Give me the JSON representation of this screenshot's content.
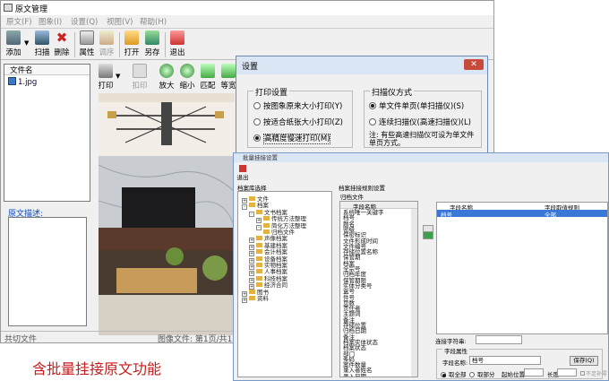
{
  "main_window": {
    "title": "原文管理",
    "menu": [
      "原文(F)",
      "图象(I)",
      "设置(Q)",
      "视图(V)",
      "帮助(H)"
    ],
    "toolbar": [
      {
        "label": "添加",
        "icon": "add-icon"
      },
      {
        "label": "扫描",
        "icon": "scan-icon"
      },
      {
        "label": "删除",
        "icon": "delete-icon"
      },
      {
        "label": "属性",
        "icon": "properties-icon"
      },
      {
        "label": "调序",
        "icon": "reorder-icon",
        "disabled": true
      },
      {
        "label": "打开",
        "icon": "open-icon"
      },
      {
        "label": "另存",
        "icon": "save-as-icon"
      },
      {
        "label": "退出",
        "icon": "exit-icon"
      }
    ],
    "file_panel": {
      "header": "文件名",
      "files": [
        "1.jpg"
      ]
    },
    "description_label": "原文描述:",
    "image_toolbar": [
      {
        "label": "打印",
        "icon": "print-icon"
      },
      {
        "label": "扣印",
        "icon": "stamp-icon",
        "disabled": true
      },
      {
        "label": "放大",
        "icon": "zoom-in-icon"
      },
      {
        "label": "缩小",
        "icon": "zoom-out-icon"
      },
      {
        "label": "匹配",
        "icon": "fit-icon"
      },
      {
        "label": "等宽",
        "icon": "fit-width-icon"
      }
    ],
    "status": {
      "left": "共切文件",
      "right": "图像文件: 第1页/共1页"
    }
  },
  "settings_dialog": {
    "title": "设置",
    "print_group": {
      "title": "打印设置",
      "options": [
        "按图象原来大小打印(Y)",
        "按适合纸张大小打印(Z)",
        "高精度慢速打印(M)"
      ],
      "selected": 2
    },
    "scan_group": {
      "title": "扫描仪方式",
      "options": [
        "单文件单页(单扫描仪)(S)",
        "连续扫描仪(高速扫描仪)(L)"
      ],
      "selected": 0,
      "note": "注: 有些高速扫描仪可设为单文件单页方式。"
    },
    "close_icon": "close-icon"
  },
  "batch_dialog": {
    "title": "批量挂接设置",
    "exit_label": "退出",
    "left_title": "档案库选择",
    "tree": [
      {
        "label": "文件",
        "indent": 0,
        "box": "+"
      },
      {
        "label": "档案",
        "indent": 0,
        "box": "-"
      },
      {
        "label": "文书档案",
        "indent": 1,
        "box": "-"
      },
      {
        "label": "传统方法整理",
        "indent": 2,
        "box": "+"
      },
      {
        "label": "简化方法整理",
        "indent": 2,
        "box": "-"
      },
      {
        "label": "归档文件",
        "indent": 3,
        "box": ""
      },
      {
        "label": "声像档案",
        "indent": 1,
        "box": "+"
      },
      {
        "label": "基建档案",
        "indent": 1,
        "box": "+"
      },
      {
        "label": "会计档案",
        "indent": 1,
        "box": "+"
      },
      {
        "label": "设备档案",
        "indent": 1,
        "box": "+"
      },
      {
        "label": "实物档案",
        "indent": 1,
        "box": "+"
      },
      {
        "label": "人事档案",
        "indent": 1,
        "box": "+"
      },
      {
        "label": "科技档案",
        "indent": 1,
        "box": "+"
      },
      {
        "label": "经济合同",
        "indent": 1,
        "box": "+"
      },
      {
        "label": "图书",
        "indent": 0,
        "box": "+"
      },
      {
        "label": "资料",
        "indent": 0,
        "box": "+"
      }
    ],
    "right_title": "档案挂接规则设置",
    "sub_title": "归档文件",
    "field_list_header": "字段名称",
    "fields": [
      "系统唯一关键字",
      "档号",
      "题名",
      "密级",
      "保密标识",
      "文件形成时间",
      "文件编号",
      "存储位置名称",
      "保管期",
      "档案",
      "全宗号",
      "归档年度",
      "保管期限",
      "实体分类号",
      "盒号",
      "件号",
      "页数",
      "责任者",
      "主题词",
      "备注",
      "存储位置",
      "归档日期",
      "备注",
      "档案实体状态",
      "档案状态",
      "部门",
      "条码",
      "案件数量",
      "录入者姓名",
      "录入日期"
    ],
    "rule_table": {
      "col1": "字段名称",
      "col2": "字段取值规则",
      "rows": [
        {
          "name": "档号",
          "rule": "全部"
        }
      ]
    },
    "connector_label": "连接字符串:",
    "field_attr_title": "字段属性",
    "field_name_label": "字段名称:",
    "field_name_value": "档号",
    "save_button": "保存(Q)",
    "opt_all": "取全部",
    "opt_part": "取部分",
    "start_label": "起始位置",
    "length_label": "长度",
    "no_zero_label": "不足补零"
  },
  "caption": "含批量挂接原文功能"
}
